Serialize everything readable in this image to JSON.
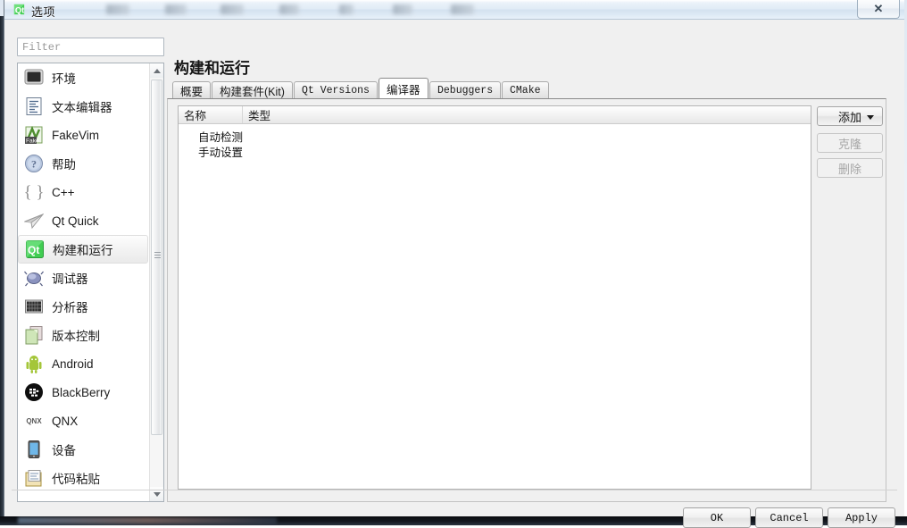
{
  "window": {
    "title": "选项",
    "app_icon": "qt-logo-icon",
    "close_label": "✕"
  },
  "sidebar": {
    "filter": {
      "value": "",
      "placeholder": "Filter"
    },
    "items": [
      {
        "label": "环境",
        "icon": "monitor-icon",
        "selected": false
      },
      {
        "label": "文本编辑器",
        "icon": "text-document-icon",
        "selected": false
      },
      {
        "label": "FakeVim",
        "icon": "fakevim-icon",
        "selected": false
      },
      {
        "label": "帮助",
        "icon": "help-question-icon",
        "selected": false
      },
      {
        "label": "C++",
        "icon": "braces-icon",
        "selected": false
      },
      {
        "label": "Qt Quick",
        "icon": "paper-plane-icon",
        "selected": false
      },
      {
        "label": "构建和运行",
        "icon": "qt-build-icon",
        "selected": true
      },
      {
        "label": "调试器",
        "icon": "bug-icon",
        "selected": false
      },
      {
        "label": "分析器",
        "icon": "analyzer-grid-icon",
        "selected": false
      },
      {
        "label": "版本控制",
        "icon": "copy-pages-icon",
        "selected": false
      },
      {
        "label": "Android",
        "icon": "android-robot-icon",
        "selected": false
      },
      {
        "label": "BlackBerry",
        "icon": "blackberry-icon",
        "selected": false
      },
      {
        "label": "QNX",
        "icon": "qnx-icon",
        "selected": false
      },
      {
        "label": "设备",
        "icon": "tablet-device-icon",
        "selected": false
      },
      {
        "label": "代码粘贴",
        "icon": "clipboard-icon",
        "selected": false
      }
    ]
  },
  "main": {
    "page_title": "构建和运行",
    "tabs": [
      {
        "label": "概要",
        "active": false,
        "latin": false
      },
      {
        "label": "构建套件(Kit)",
        "active": false,
        "latin": false
      },
      {
        "label": "Qt Versions",
        "active": false,
        "latin": true
      },
      {
        "label": "编译器",
        "active": true,
        "latin": false
      },
      {
        "label": "Debuggers",
        "active": false,
        "latin": true
      },
      {
        "label": "CMake",
        "active": false,
        "latin": true
      }
    ],
    "table": {
      "columns": [
        "名称",
        "类型"
      ],
      "rows": [
        {
          "name": "自动检测",
          "type": ""
        },
        {
          "name": "手动设置",
          "type": ""
        }
      ]
    },
    "side_buttons": [
      {
        "label": "添加",
        "enabled": true,
        "has_menu": true
      },
      {
        "label": "克隆",
        "enabled": false,
        "has_menu": false
      },
      {
        "label": "删除",
        "enabled": false,
        "has_menu": false
      }
    ]
  },
  "footer": {
    "ok": "OK",
    "cancel": "Cancel",
    "apply": "Apply"
  },
  "colors": {
    "dialog_bg": "#f0f0f0",
    "titlebar": "#e2ecf6",
    "selected_item": "#f6f6f6",
    "accent_qt_green": "#41cd52"
  }
}
